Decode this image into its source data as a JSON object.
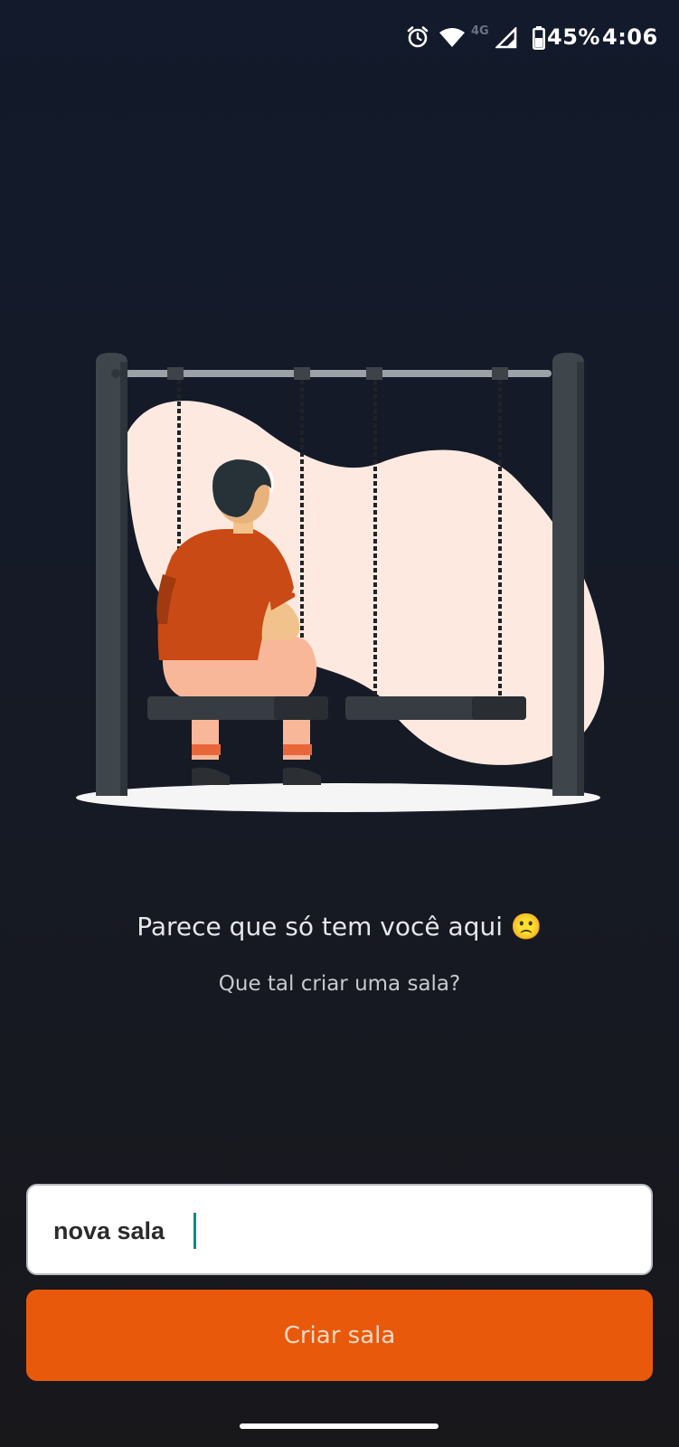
{
  "status_bar": {
    "network_label": "4G",
    "battery": "45%",
    "time": "4:06",
    "icons": [
      "alarm-icon",
      "wifi-icon",
      "signal-icon",
      "battery-icon"
    ]
  },
  "empty_state": {
    "title": "Parece que só tem você aqui 🙁",
    "subtitle": "Que tal criar uma sala?"
  },
  "room_form": {
    "input_value": "nova sala",
    "create_button_label": "Criar sala"
  },
  "colors": {
    "background": "#111827",
    "accent": "#e8590c",
    "caret": "#12897f"
  }
}
